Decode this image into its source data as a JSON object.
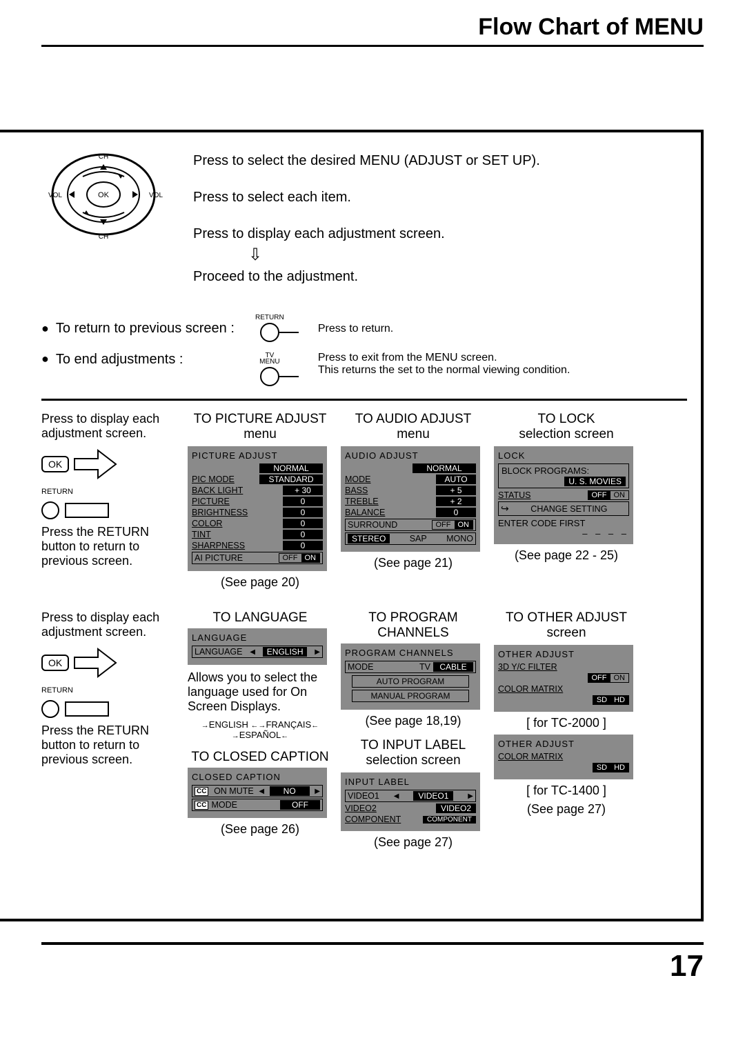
{
  "title": "Flow Chart of MENU",
  "page_number": "17",
  "remote": {
    "ch": "CH",
    "vol": "VOL",
    "ok": "OK"
  },
  "instructions": {
    "i1": "Press to select the desired MENU (ADJUST or SET UP).",
    "i2": "Press to select each item.",
    "i3": "Press to display each adjustment screen.",
    "i4": "Proceed to the adjustment."
  },
  "return_row": {
    "left": "To return to previous screen :",
    "btn_label": "RETURN",
    "right": "Press to return."
  },
  "end_row": {
    "left": "To end adjustments :",
    "btn_line1": "TV",
    "btn_line2": "MENU",
    "right1": "Press to exit from the MENU screen.",
    "right2": "This returns the set to the normal viewing condition."
  },
  "left_block": {
    "display_each": "Press to display each adjustment screen.",
    "ok": "OK",
    "return_label": "RETURN",
    "return_text": "Press the RETURN button to return to previous screen."
  },
  "picture": {
    "head": "TO PICTURE ADJUST",
    "sub": "menu",
    "hdr": "PICTURE  ADJUST",
    "normal": "NORMAL",
    "rows": [
      {
        "k": "PIC  MODE",
        "v": "STANDARD"
      },
      {
        "k": "BACK  LIGHT",
        "v": "+ 30"
      },
      {
        "k": "PICTURE",
        "v": "0"
      },
      {
        "k": "BRIGHTNESS",
        "v": "0"
      },
      {
        "k": "COLOR",
        "v": "0"
      },
      {
        "k": "TINT",
        "v": "0"
      },
      {
        "k": "SHARPNESS",
        "v": "0"
      }
    ],
    "ai": "AI  PICTURE",
    "ai_off": "OFF",
    "ai_on": "ON",
    "see": "(See page 20)"
  },
  "audio": {
    "head": "TO AUDIO ADJUST",
    "sub": "menu",
    "hdr": "AUDIO  ADJUST",
    "normal": "NORMAL",
    "rows": [
      {
        "k": "MODE",
        "v": "AUTO"
      },
      {
        "k": "BASS",
        "v": "+ 5"
      },
      {
        "k": "TREBLE",
        "v": "+ 2"
      },
      {
        "k": "BALANCE",
        "v": "0"
      }
    ],
    "surround": "SURROUND",
    "surr_off": "OFF",
    "surr_on": "ON",
    "stereo": "STEREO",
    "sap": "SAP",
    "mono": "MONO",
    "see": "(See page 21)"
  },
  "lock": {
    "head": "TO LOCK",
    "sub": "selection screen",
    "hdr": "LOCK",
    "block": "BLOCK  PROGRAMS:",
    "block_val": "U. S.    MOVIES",
    "status": "STATUS",
    "off": "OFF",
    "on": "ON",
    "change": "CHANGE  SETTING",
    "change_icon": "↪",
    "enter": "ENTER  CODE  FIRST",
    "dash": "– – – –",
    "see": "(See page 22 - 25)"
  },
  "language": {
    "head": "TO LANGUAGE",
    "hdr": "LANGUAGE",
    "row_k": "LANGUAGE",
    "row_v": "ENGLISH",
    "note": "Allows you to select the language used for On Screen Displays.",
    "opt1": "ENGLISH",
    "opt2": "FRANÇAIS",
    "opt3": "ESPAÑOL"
  },
  "program": {
    "head": "TO PROGRAM CHANNELS",
    "hdr": "PROGRAM  CHANNELS",
    "mode": "MODE",
    "tv": "TV",
    "cable": "CABLE",
    "auto": "AUTO  PROGRAM",
    "manual": "MANUAL  PROGRAM",
    "see": "(See page 18,19)"
  },
  "other": {
    "head": "TO OTHER ADJUST",
    "sub": "screen",
    "hdr": "OTHER  ADJUST",
    "yc": "3D  Y/C  FILTER",
    "off": "OFF",
    "on": "ON",
    "matrix": "COLOR  MATRIX",
    "sd": "SD",
    "hd": "HD",
    "model1": "[ for TC-2000 ]",
    "hdr2": "OTHER  ADJUST",
    "model2": "[ for TC-1400 ]",
    "see": "(See page 27)"
  },
  "caption": {
    "head": "TO CLOSED CAPTION",
    "hdr": "CLOSED  CAPTION",
    "cc": "CC",
    "onmute": "ON MUTE",
    "no": "NO",
    "mode": "MODE",
    "off": "OFF",
    "see": "(See page 26)"
  },
  "input": {
    "head": "TO INPUT LABEL",
    "sub": "selection screen",
    "hdr": "INPUT  LABEL",
    "v1": "VIDEO1",
    "v1r": "VIDEO1",
    "v2": "VIDEO2",
    "v2r": "VIDEO2",
    "comp": "COMPONENT",
    "compr": "COMPONENT",
    "see": "(See page 27)"
  }
}
